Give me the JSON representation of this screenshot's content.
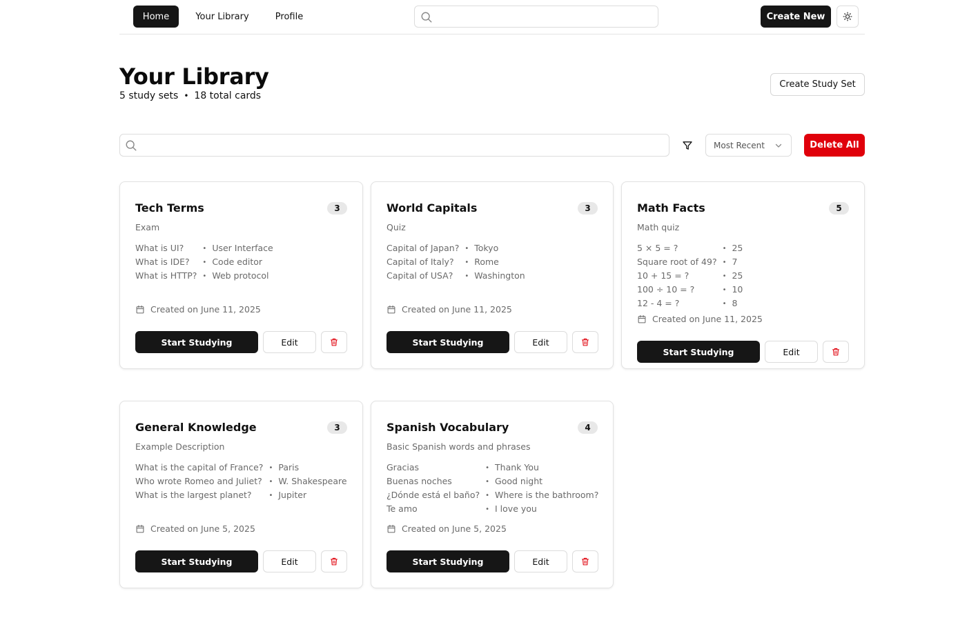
{
  "nav": {
    "home": "Home",
    "library": "Your Library",
    "profile": "Profile",
    "search_placeholder": "",
    "create_new": "Create New",
    "theme_icon": "sun-icon"
  },
  "header": {
    "title": "Your Library",
    "sets_count": "5 study sets",
    "cards_count": "18 total cards",
    "separator": "•",
    "create_set": "Create Study Set"
  },
  "toolbar": {
    "search_placeholder": "",
    "sort_value": "Most Recent",
    "delete_all": "Delete All"
  },
  "colors": {
    "primary": "#161616",
    "danger": "#e0000b",
    "muted_text": "#6a6a6a"
  },
  "sets": [
    {
      "title": "Tech Terms",
      "count": "3",
      "description": "Exam",
      "items": [
        {
          "q": "What is UI?",
          "a": "User Interface"
        },
        {
          "q": "What is IDE?",
          "a": "Code editor"
        },
        {
          "q": "What is HTTP?",
          "a": "Web protocol"
        }
      ],
      "created": "Created on June 11, 2025",
      "start_label": "Start Studying",
      "edit_label": "Edit"
    },
    {
      "title": "World Capitals",
      "count": "3",
      "description": "Quiz",
      "items": [
        {
          "q": "Capital of Japan?",
          "a": "Tokyo"
        },
        {
          "q": "Capital of Italy?",
          "a": "Rome"
        },
        {
          "q": "Capital of USA?",
          "a": "Washington"
        }
      ],
      "created": "Created on June 11, 2025",
      "start_label": "Start Studying",
      "edit_label": "Edit"
    },
    {
      "title": "Math Facts",
      "count": "5",
      "description": "Math quiz",
      "items": [
        {
          "q": "5 × 5 = ?",
          "a": "25"
        },
        {
          "q": "Square root of 49?",
          "a": "7"
        },
        {
          "q": "10 + 15 = ?",
          "a": "25"
        },
        {
          "q": "100 ÷ 10 = ?",
          "a": "10"
        },
        {
          "q": "12 - 4 = ?",
          "a": "8"
        }
      ],
      "created": "Created on June 11, 2025",
      "start_label": "Start Studying",
      "edit_label": "Edit"
    },
    {
      "title": "General Knowledge",
      "count": "3",
      "description": "Example Description",
      "items": [
        {
          "q": "What is the capital of France?",
          "a": "Paris"
        },
        {
          "q": "Who wrote Romeo and Juliet?",
          "a": "W. Shakespeare"
        },
        {
          "q": "What is the largest planet?",
          "a": "Jupiter"
        }
      ],
      "created": "Created on June 5, 2025",
      "start_label": "Start Studying",
      "edit_label": "Edit"
    },
    {
      "title": "Spanish Vocabulary",
      "count": "4",
      "description": "Basic Spanish words and phrases",
      "items": [
        {
          "q": "Gracias",
          "a": "Thank You"
        },
        {
          "q": "Buenas noches",
          "a": "Good night"
        },
        {
          "q": "¿Dónde está el baño?",
          "a": "Where is the bathroom?"
        },
        {
          "q": "Te amo",
          "a": "I love you"
        }
      ],
      "created": "Created on June 5, 2025",
      "start_label": "Start Studying",
      "edit_label": "Edit"
    }
  ]
}
